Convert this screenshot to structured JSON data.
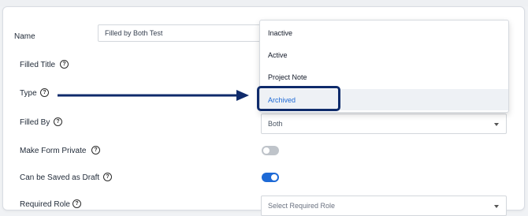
{
  "form": {
    "name_label": "Name",
    "name_value": "Filled by Both Test",
    "filled_title_label": "Filled Title",
    "type_label": "Type",
    "filled_by_label": "Filled By",
    "filled_by_value": "Both",
    "make_private_label": "Make Form Private",
    "make_private_on": false,
    "save_draft_label": "Can be Saved as Draft",
    "save_draft_on": true,
    "required_role_label": "Required Role",
    "required_role_placeholder": "Select Required Role",
    "help_glyph": "?"
  },
  "type_dropdown": {
    "options": [
      "Inactive",
      "Active",
      "Project Note",
      "Archived"
    ],
    "selected": "Archived"
  },
  "colors": {
    "accent": "#1e6ad6",
    "annotation": "#0f2b6b",
    "toggle_off": "#bfc4ca"
  },
  "icons": [
    "help-circle-icon",
    "chevron-down-icon",
    "annotation-arrow"
  ]
}
